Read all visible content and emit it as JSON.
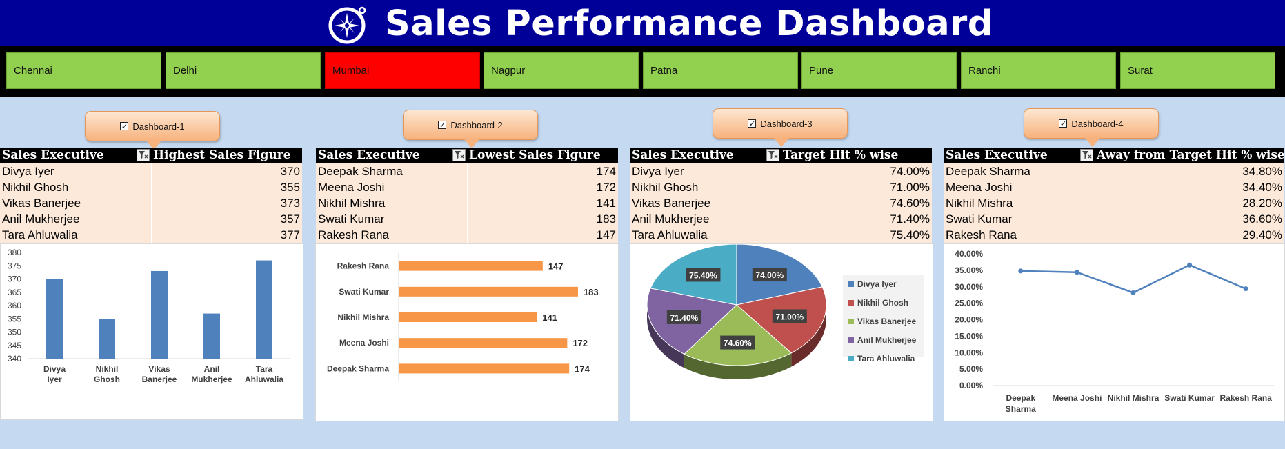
{
  "header": {
    "title": "Sales Performance Dashboard",
    "logo_icon": "compass-star-icon",
    "background": "#000099"
  },
  "cities": [
    {
      "label": "Chennai",
      "active": false
    },
    {
      "label": "Delhi",
      "active": false
    },
    {
      "label": "Mumbai",
      "active": true
    },
    {
      "label": "Nagpur",
      "active": false
    },
    {
      "label": "Patna",
      "active": false
    },
    {
      "label": "Pune",
      "active": false
    },
    {
      "label": "Ranchi",
      "active": false
    },
    {
      "label": "Surat",
      "active": false
    }
  ],
  "colors": {
    "city_inactive": "#92d050",
    "city_active": "#ff0000",
    "table_body": "#fde9d9",
    "page_bg": "#c5d9f1"
  },
  "dashboards": [
    {
      "label": "Dashboard-1",
      "checked": true,
      "col1": "Sales Executive",
      "col2": "Highest Sales Figure",
      "rows": [
        {
          "name": "Divya Iyer",
          "value": "370"
        },
        {
          "name": "Nikhil Ghosh",
          "value": "355"
        },
        {
          "name": "Vikas Banerjee",
          "value": "373"
        },
        {
          "name": "Anil Mukherjee",
          "value": "357"
        },
        {
          "name": "Tara Ahluwalia",
          "value": "377"
        }
      ]
    },
    {
      "label": "Dashboard-2",
      "checked": true,
      "col1": "Sales Executive",
      "col2": "Lowest Sales Figure",
      "rows": [
        {
          "name": "Deepak Sharma",
          "value": "174"
        },
        {
          "name": "Meena Joshi",
          "value": "172"
        },
        {
          "name": "Nikhil Mishra",
          "value": "141"
        },
        {
          "name": "Swati Kumar",
          "value": "183"
        },
        {
          "name": "Rakesh Rana",
          "value": "147"
        }
      ]
    },
    {
      "label": "Dashboard-3",
      "checked": true,
      "col1": "Sales Executive",
      "col2": "Target Hit % wise",
      "rows": [
        {
          "name": "Divya Iyer",
          "value": "74.00%"
        },
        {
          "name": "Nikhil Ghosh",
          "value": "71.00%"
        },
        {
          "name": "Vikas Banerjee",
          "value": "74.60%"
        },
        {
          "name": "Anil Mukherjee",
          "value": "71.40%"
        },
        {
          "name": "Tara Ahluwalia",
          "value": "75.40%"
        }
      ]
    },
    {
      "label": "Dashboard-4",
      "checked": true,
      "col1": "Sales Executive",
      "col2": "Away from Target Hit % wise",
      "rows": [
        {
          "name": "Deepak Sharma",
          "value": "34.80%"
        },
        {
          "name": "Meena Joshi",
          "value": "34.40%"
        },
        {
          "name": "Nikhil Mishra",
          "value": "28.20%"
        },
        {
          "name": "Swati Kumar",
          "value": "36.60%"
        },
        {
          "name": "Rakesh Rana",
          "value": "29.40%"
        }
      ]
    }
  ],
  "chart_data": [
    {
      "type": "bar",
      "categories": [
        "Divya Iyer",
        "Nikhil Ghosh",
        "Vikas Banerjee",
        "Anil Mukherjee",
        "Tara Ahluwalia"
      ],
      "values": [
        370,
        355,
        373,
        357,
        377
      ],
      "ylim": [
        340,
        380
      ],
      "yticks": [
        340,
        345,
        350,
        355,
        360,
        365,
        370,
        375,
        380
      ],
      "color": "#4f81bd",
      "grid": false
    },
    {
      "type": "bar",
      "orientation": "horizontal",
      "categories": [
        "Rakesh Rana",
        "Swati Kumar",
        "Nikhil Mishra",
        "Meena Joshi",
        "Deepak Sharma"
      ],
      "values": [
        147,
        183,
        141,
        172,
        174
      ],
      "color": "#f79646",
      "data_labels": true
    },
    {
      "type": "pie",
      "style": "3d",
      "categories": [
        "Divya Iyer",
        "Nikhil Ghosh",
        "Vikas Banerjee",
        "Anil Mukherjee",
        "Tara Ahluwalia"
      ],
      "values": [
        74.0,
        71.0,
        74.6,
        71.4,
        75.4
      ],
      "labels": [
        "74.00%",
        "71.00%",
        "74.60%",
        "71.40%",
        "75.40%"
      ],
      "colors": [
        "#4f81bd",
        "#c0504d",
        "#9bbb59",
        "#8064a2",
        "#4bacc6"
      ],
      "legend": "right"
    },
    {
      "type": "line",
      "categories": [
        "Deepak Sharma",
        "Meena Joshi",
        "Nikhil Mishra",
        "Swati Kumar",
        "Rakesh Rana"
      ],
      "values": [
        34.8,
        34.4,
        28.2,
        36.6,
        29.4
      ],
      "ylim": [
        0,
        40
      ],
      "yticks": [
        "0.00%",
        "5.00%",
        "10.00%",
        "15.00%",
        "20.00%",
        "25.00%",
        "30.00%",
        "35.00%",
        "40.00%"
      ],
      "color": "#4f81bd",
      "grid": false
    }
  ]
}
